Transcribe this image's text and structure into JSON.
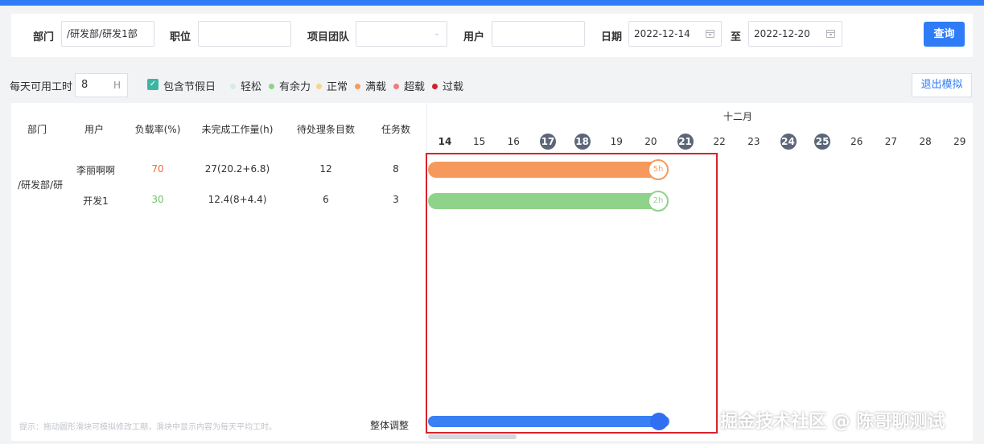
{
  "filters": {
    "dept_label": "部门",
    "dept_value": "/研发部/研发1部",
    "position_label": "职位",
    "position_value": "",
    "team_label": "项目团队",
    "team_value": "",
    "user_label": "用户",
    "user_value": "",
    "date_label": "日期",
    "date_from": "2022-12-14",
    "date_sep": "至",
    "date_to": "2022-12-20",
    "query_label": "查询"
  },
  "options": {
    "daily_hours_label": "每天可用工时",
    "daily_hours_value": "8",
    "daily_hours_unit": "H",
    "include_holiday_label": "包含节假日",
    "include_holiday_checked": true,
    "exit_label": "退出模拟"
  },
  "legend": [
    {
      "label": "轻松",
      "color": "#d8ecdc"
    },
    {
      "label": "有余力",
      "color": "#8ed389"
    },
    {
      "label": "正常",
      "color": "#f6d58a"
    },
    {
      "label": "满载",
      "color": "#f59a5c"
    },
    {
      "label": "超载",
      "color": "#ef7b7b"
    },
    {
      "label": "过载",
      "color": "#d0202a"
    }
  ],
  "table": {
    "headers": [
      "部门",
      "用户",
      "负载率(%)",
      "未完成工作量(h)",
      "待处理条目数",
      "任务数"
    ],
    "dept": "/研发部/研",
    "rows": [
      {
        "user": "李丽啊啊",
        "load": "70",
        "load_color": "#f06a3c",
        "unfinished": "27(20.2+6.8)",
        "pending": "12",
        "tasks": "8"
      },
      {
        "user": "开发1",
        "load": "30",
        "load_color": "#6cc46a",
        "unfinished": "12.4(8+4.4)",
        "pending": "6",
        "tasks": "3"
      }
    ],
    "hint": "提示：拖动圆形滑块可模拟修改工期，滑块中显示内容为每天平均工时。",
    "adjust_label": "整体调整"
  },
  "gantt": {
    "month": "十二月",
    "days": [
      {
        "d": "14",
        "weekend": false,
        "current": true
      },
      {
        "d": "15",
        "weekend": false
      },
      {
        "d": "16",
        "weekend": false
      },
      {
        "d": "17",
        "weekend": true
      },
      {
        "d": "18",
        "weekend": true
      },
      {
        "d": "19",
        "weekend": false
      },
      {
        "d": "20",
        "weekend": false
      },
      {
        "d": "21",
        "weekend": true
      },
      {
        "d": "22",
        "weekend": false
      },
      {
        "d": "23",
        "weekend": false
      },
      {
        "d": "24",
        "weekend": true
      },
      {
        "d": "25",
        "weekend": true
      },
      {
        "d": "26",
        "weekend": false
      },
      {
        "d": "27",
        "weekend": false
      },
      {
        "d": "28",
        "weekend": false
      },
      {
        "d": "29",
        "weekend": false
      }
    ],
    "bars": [
      {
        "label": "5h",
        "color": "#f59a5c"
      },
      {
        "label": "2h",
        "color": "#8ed389"
      }
    ]
  },
  "watermark": "掘金技术社区 @ 陈哥聊测试"
}
